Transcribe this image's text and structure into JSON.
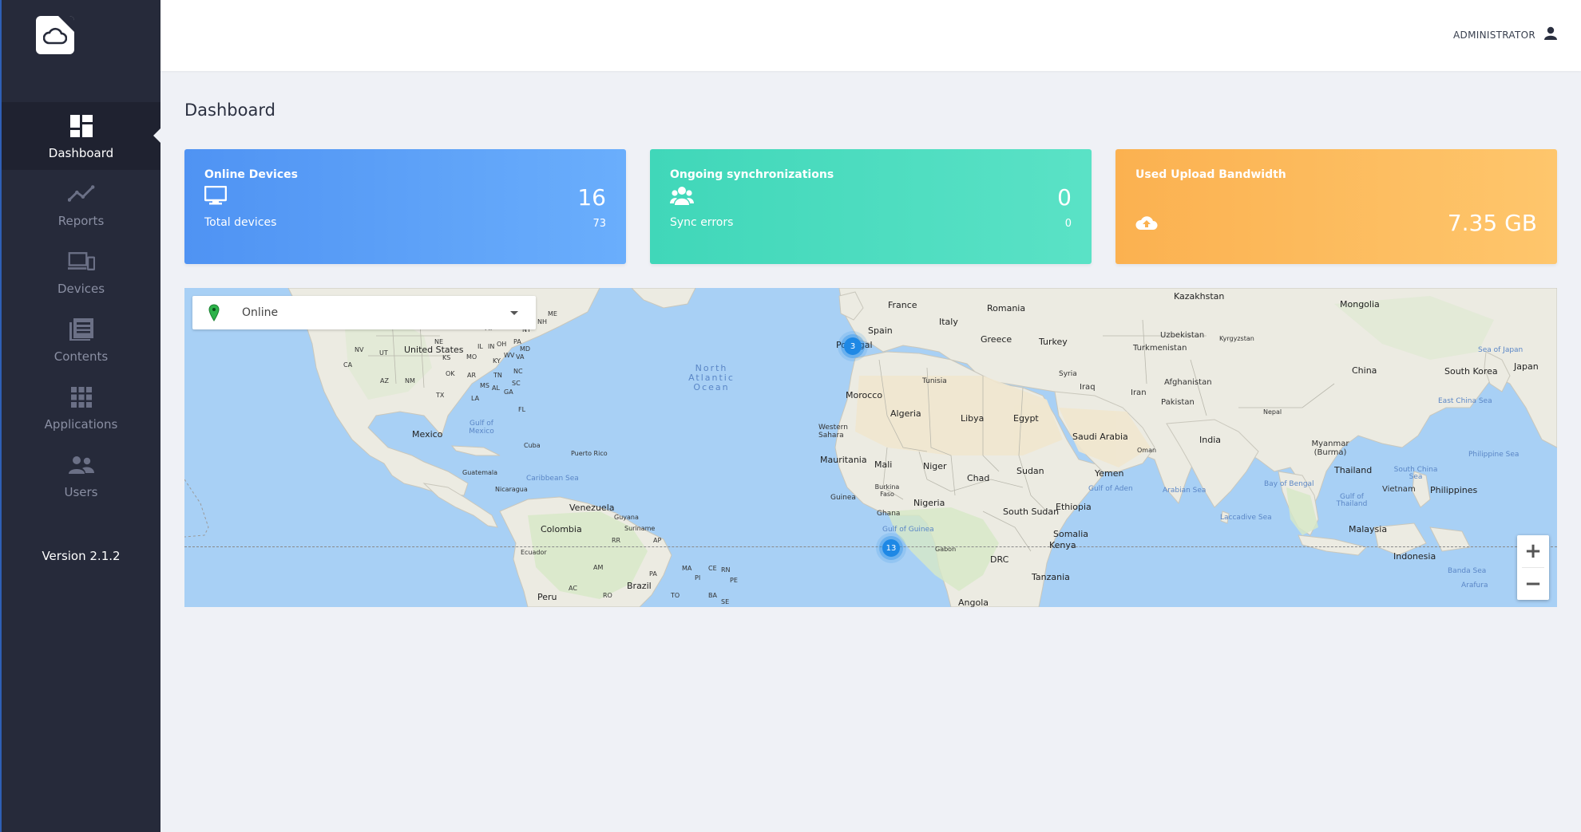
{
  "sidebar": {
    "logo_icon": "cloud-logo-icon",
    "items": [
      {
        "label": "Dashboard",
        "icon": "dashboard-icon",
        "active": true
      },
      {
        "label": "Reports",
        "icon": "chart-line-icon"
      },
      {
        "label": "Devices",
        "icon": "devices-icon"
      },
      {
        "label": "Contents",
        "icon": "contents-icon"
      },
      {
        "label": "Applications",
        "icon": "apps-grid-icon"
      },
      {
        "label": "Users",
        "icon": "users-icon"
      }
    ],
    "version": "Version 2.1.2"
  },
  "header": {
    "user_label": "ADMINISTRATOR",
    "user_icon": "user-icon"
  },
  "page": {
    "title": "Dashboard"
  },
  "cards": {
    "online": {
      "title": "Online Devices",
      "value": "16",
      "sub_label": "Total devices",
      "sub_value": "73",
      "icon": "monitor-icon",
      "color": "#4f93f3"
    },
    "sync": {
      "title": "Ongoing synchronizations",
      "value": "0",
      "sub_label": "Sync errors",
      "sub_value": "0",
      "icon": "users-icon",
      "color": "#40d7b9"
    },
    "bandwidth": {
      "title": "Used Upload Bandwidth",
      "value": "7.35 GB",
      "icon": "cloud-upload-icon",
      "color": "#fbb150"
    }
  },
  "map": {
    "filter": {
      "value": "Online",
      "icon": "map-pin-icon"
    },
    "clusters": [
      {
        "count": "3"
      },
      {
        "count": "13"
      }
    ],
    "zoom_in": "+",
    "zoom_out": "−",
    "labels": {
      "kazakhstan": "Kazakhstan",
      "mongolia": "Mongolia",
      "france": "France",
      "romania": "Romania",
      "italy": "Italy",
      "spain": "Spain",
      "portugal": "Portugal",
      "greece": "Greece",
      "turkey": "Turkey",
      "uzbekistan": "Uzbekistan",
      "turkmenistan": "Turkmenistan",
      "kyrgyzstan": "Kyrgyzstan",
      "china": "China",
      "south_korea": "South Korea",
      "japan": "Japan",
      "sea_of_japan": "Sea of Japan",
      "tunisia": "Tunisia",
      "syria": "Syria",
      "iraq": "Iraq",
      "iran": "Iran",
      "afghanistan": "Afghanistan",
      "pakistan": "Pakistan",
      "nepal": "Nepal",
      "east_china_sea": "East China Sea",
      "morocco": "Morocco",
      "algeria": "Algeria",
      "libya": "Libya",
      "egypt": "Egypt",
      "saudi_arabia": "Saudi Arabia",
      "india": "India",
      "myanmar": "Myanmar (Burma)",
      "western_sahara": "Western Sahara",
      "oman": "Oman",
      "philippine_sea": "Philippine Sea",
      "mauritania": "Mauritania",
      "mali": "Mali",
      "niger": "Niger",
      "chad": "Chad",
      "sudan": "Sudan",
      "yemen": "Yemen",
      "thailand": "Thailand",
      "south_china_sea": "South China Sea",
      "burkina_faso": "Burkina Faso",
      "gulf_of_aden": "Gulf of Aden",
      "arabian_sea": "Arabian Sea",
      "bay_of_bengal": "Bay of Bengal",
      "vietnam": "Vietnam",
      "philippines": "Philippines",
      "guinea": "Guinea",
      "nigeria": "Nigeria",
      "ethiopia": "Ethiopia",
      "gulf_of_thailand": "Gulf of Thailand",
      "ghana": "Ghana",
      "south_sudan": "South Sudan",
      "laccadive_sea": "Laccadive Sea",
      "gulf_of_guinea": "Gulf of Guinea",
      "somalia": "Somalia",
      "malaysia": "Malaysia",
      "gabon": "Gabon",
      "kenya": "Kenya",
      "drc": "DRC",
      "indonesia": "Indonesia",
      "tanzania": "Tanzania",
      "banda_sea": "Banda Sea",
      "arafura": "Arafura",
      "angola": "Angola",
      "united_states": "United States",
      "mexico": "Mexico",
      "gulf_of_mexico": "Gulf of Mexico",
      "cuba": "Cuba",
      "puerto_rico": "Puerto Rico",
      "guatemala": "Guatemala",
      "nicaragua": "Nicaragua",
      "caribbean_sea": "Caribbean Sea",
      "venezuela": "Venezuela",
      "guyana": "Guyana",
      "suriname": "Suriname",
      "colombia": "Colombia",
      "ecuador": "Ecuador",
      "peru": "Peru",
      "brazil": "Brazil",
      "north_atlantic_ocean": "North Atlantic Ocean",
      "st_nv": "NV",
      "st_ut": "UT",
      "st_ca": "CA",
      "st_az": "AZ",
      "st_nm": "NM",
      "st_ks": "KS",
      "st_mo": "MO",
      "st_ok": "OK",
      "st_ar": "AR",
      "st_tx": "TX",
      "st_ms": "MS",
      "st_al": "AL",
      "st_ga": "GA",
      "st_la": "LA",
      "st_tn": "TN",
      "st_sc": "SC",
      "st_nc": "NC",
      "st_va": "VA",
      "st_wv": "WV",
      "st_oh": "OH",
      "st_pa": "PA",
      "st_ny": "NY",
      "st_me": "ME",
      "st_nh": "NH",
      "st_md": "MD",
      "st_ne": "NE",
      "st_il": "IL",
      "st_in": "IN",
      "st_ky": "KY",
      "st_fl": "FL",
      "st_mi": "MI",
      "br_rr": "RR",
      "br_ap": "AP",
      "br_am": "AM",
      "br_pa": "PA",
      "br_ma": "MA",
      "br_ce": "CE",
      "br_rn": "RN",
      "br_pi": "PI",
      "br_pe": "PE",
      "br_ac": "AC",
      "br_ro": "RO",
      "br_to": "TO",
      "br_ba": "BA",
      "br_se": "SE"
    }
  }
}
